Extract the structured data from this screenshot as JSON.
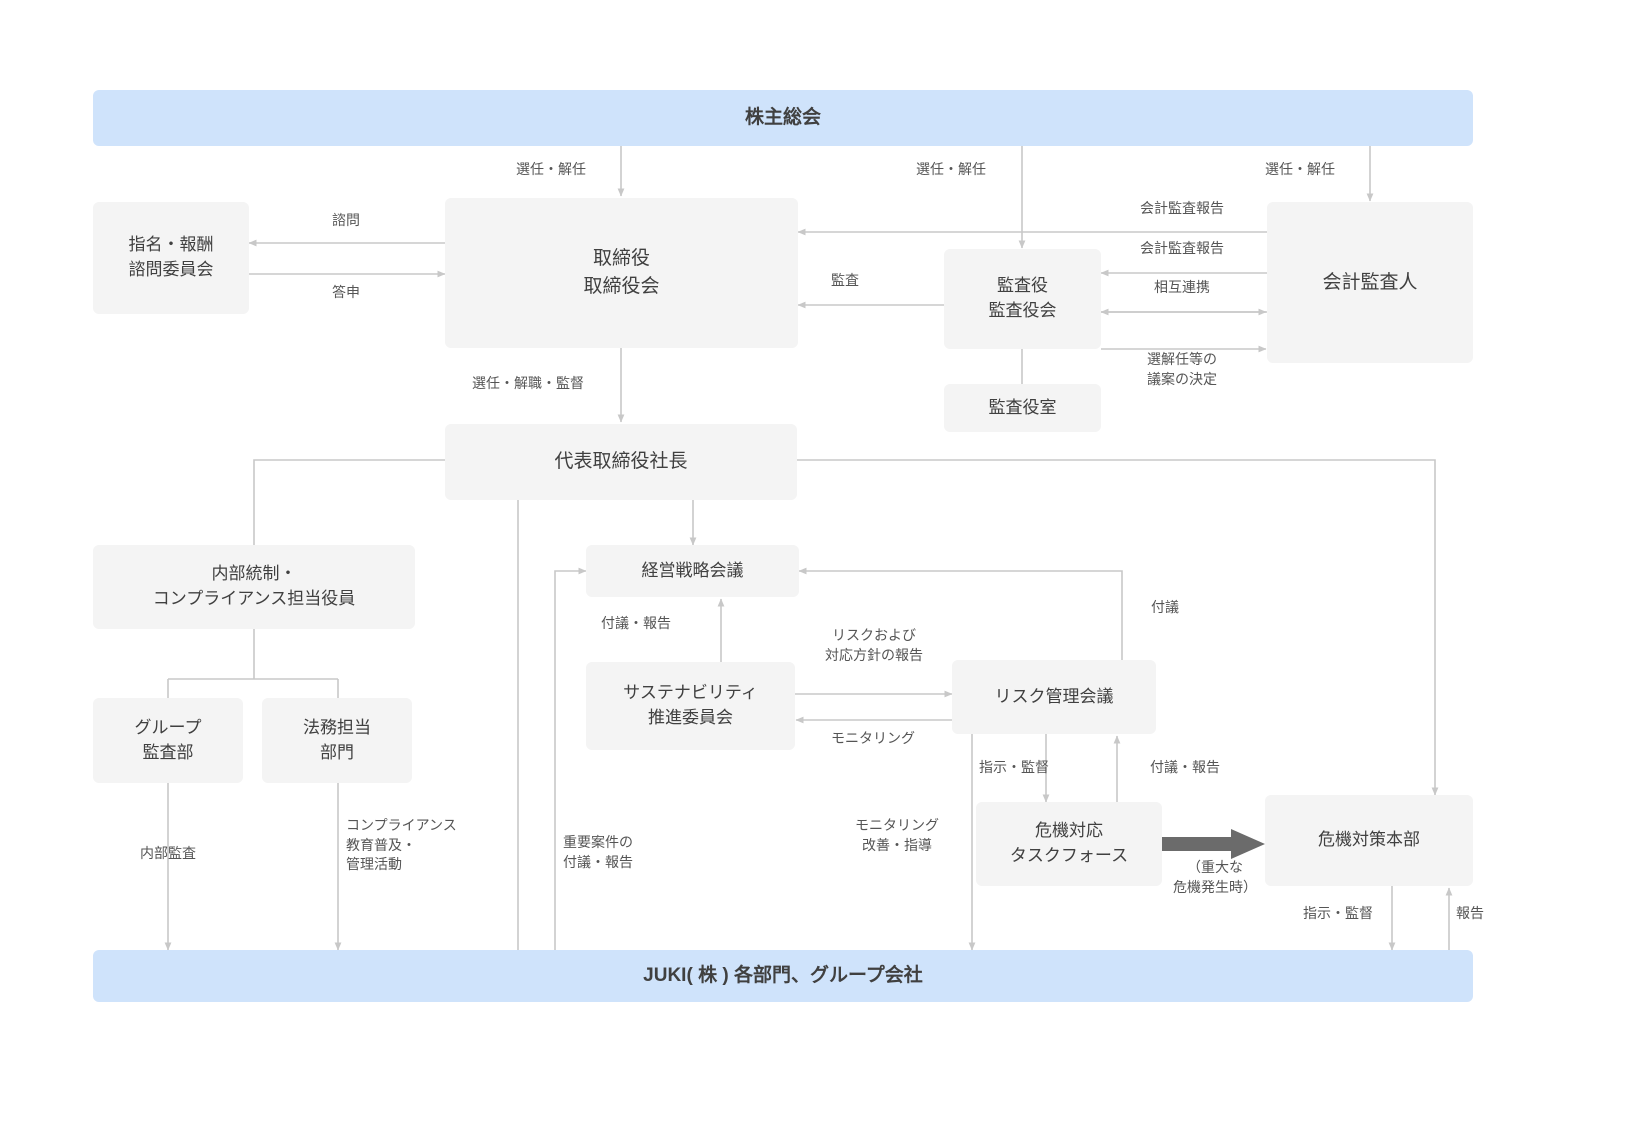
{
  "diagram": {
    "title_banner": "株主総会",
    "bottom_banner": "JUKI( 株 ) 各部門、グループ会社",
    "colors": {
      "banner_blue": "#cfe3fb",
      "node_grey": "#f4f4f4",
      "text": "#404040",
      "label_text": "#555555",
      "line": "#c8c8c8",
      "thick_arrow": "#6b6b6b"
    },
    "nodes": {
      "shareholders_meeting": "株主総会",
      "nomination_committee": "指名・報酬\n諮問委員会",
      "board_of_directors": "取締役\n取締役会",
      "audit_and_supervisory": "監査役\n監査役会",
      "audit_office": "監査役室",
      "accounting_auditor": "会計監査人",
      "president": "代表取締役社長",
      "internal_control_officer": "内部統制・\nコンプライアンス担当役員",
      "group_audit_dept": "グループ\n監査部",
      "legal_dept": "法務担当\n部門",
      "management_strategy_meeting": "経営戦略会議",
      "sustainability_committee": "サステナビリティ\n推進委員会",
      "risk_management_meeting": "リスク管理会議",
      "crisis_task_force": "危機対応\nタスクフォース",
      "crisis_headquarters": "危機対策本部",
      "bottom_departments": "JUKI( 株 ) 各部門、グループ会社"
    },
    "edge_labels": {
      "appoint_dismiss_board": "選任・解任",
      "appoint_dismiss_auditor": "選任・解任",
      "appoint_dismiss_accounting": "選任・解任",
      "consultation": "諮問",
      "report_back": "答申",
      "audit": "監査",
      "accounting_audit_report_1": "会計監査報告",
      "accounting_audit_report_2": "会計監査報告",
      "mutual_cooperation": "相互連携",
      "appointment_proposal": "選解任等の\n議案の決定",
      "appoint_dismiss_supervise": "選任・解職・監督",
      "submission_report": "付議・報告",
      "risk_and_policy_report": "リスクおよび\n対応方針の報告",
      "monitoring": "モニタリング",
      "submission": "付議",
      "instruction_supervision_rm": "指示・監督",
      "submission_report_tf": "付議・報告",
      "monitoring_improvement": "モニタリング\n改善・指導",
      "internal_audit": "内部監査",
      "compliance_education": "コンプライアンス\n教育普及・\n管理活動",
      "important_matters": "重要案件の\n付議・報告",
      "serious_crisis": "（重大な\n危機発生時）",
      "instruction_supervision_hq": "指示・監督",
      "report_hq": "報告"
    }
  }
}
